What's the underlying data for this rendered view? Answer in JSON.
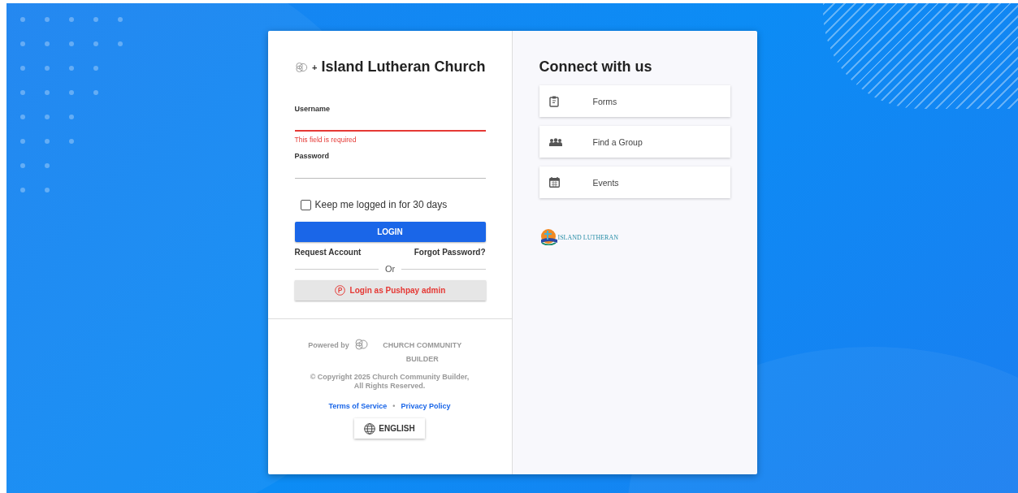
{
  "login": {
    "title": "Island Lutheran Church",
    "separator": "+",
    "fields": [
      {
        "label": "Username",
        "error": "This field is required"
      },
      {
        "label": "Password"
      }
    ],
    "remember": {
      "label": "Keep me logged in for 30 days",
      "checked": false
    },
    "login_button": "LOGIN",
    "links": [
      "Request Account",
      "Forgot Password?"
    ],
    "divider": "Or",
    "pushpay_button": "Login as Pushpay admin"
  },
  "footer": {
    "powered_by": "Powered by",
    "brand": "CHURCH COMMUNITY BUILDER",
    "copyright": "© Copyright 2025 Church Community Builder, All Rights Reserved.",
    "links": [
      "Terms of Service",
      "Privacy Policy"
    ],
    "link_separator": "•",
    "language_button": "ENGLISH"
  },
  "connect": {
    "title": "Connect with us",
    "items": [
      {
        "label": "Forms",
        "kind": "forms"
      },
      {
        "label": "Find a Group",
        "kind": "group"
      },
      {
        "label": "Events",
        "kind": "calendar"
      }
    ],
    "logo_text": "ISLAND LUTHERAN"
  }
}
